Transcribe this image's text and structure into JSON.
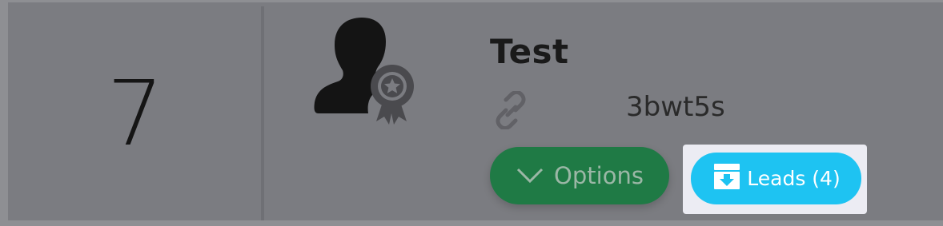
{
  "row": {
    "rank": "7",
    "title": "Test",
    "code": "3bwt5s",
    "options_label": "Options",
    "leads_label": "Leads (4)"
  },
  "icons": {
    "avatar": "user-award-icon",
    "link": "link-icon",
    "options_chevron": "chevron-down-icon",
    "leads": "inbox-download-icon"
  },
  "colors": {
    "options_button": "#1f7a45",
    "leads_button": "#1ec3f2"
  }
}
